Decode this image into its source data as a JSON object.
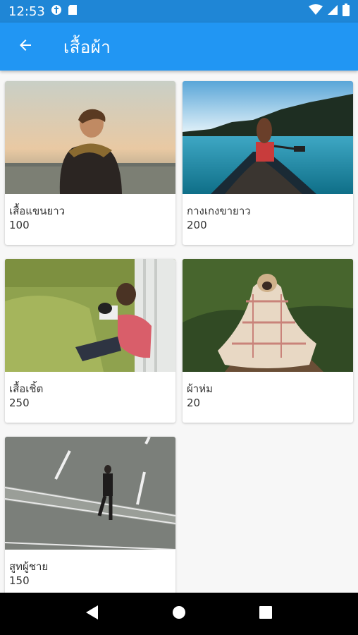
{
  "status_bar": {
    "time": "12:53",
    "icons": [
      "shield-icon",
      "sd-card-icon",
      "wifi-icon",
      "signal-icon",
      "battery-icon"
    ]
  },
  "app_bar": {
    "title": "เสื้อผ้า",
    "back_icon": "arrow-back-icon"
  },
  "colors": {
    "app_bar": "#2196f3",
    "status_bar": "#1f86d6",
    "nav_bar": "#000000"
  },
  "items": [
    {
      "name": "เสื้อแขนยาว",
      "qty": "100",
      "image": "man-in-jacket-at-seaside-photo"
    },
    {
      "name": "กางเกงขายาว",
      "qty": "200",
      "image": "woman-in-canoe-on-lake-photo"
    },
    {
      "name": "เสื้อเชิ้ต",
      "qty": "250",
      "image": "man-reading-on-grass-photo"
    },
    {
      "name": "ผ้าห่ม",
      "qty": "20",
      "image": "pug-in-blanket-photo"
    },
    {
      "name": "สูทผู้ชาย",
      "qty": "150",
      "image": "man-in-suit-on-road-photo"
    }
  ],
  "nav_bar": {
    "icons": [
      "back-triangle-icon",
      "home-circle-icon",
      "recents-square-icon"
    ]
  }
}
